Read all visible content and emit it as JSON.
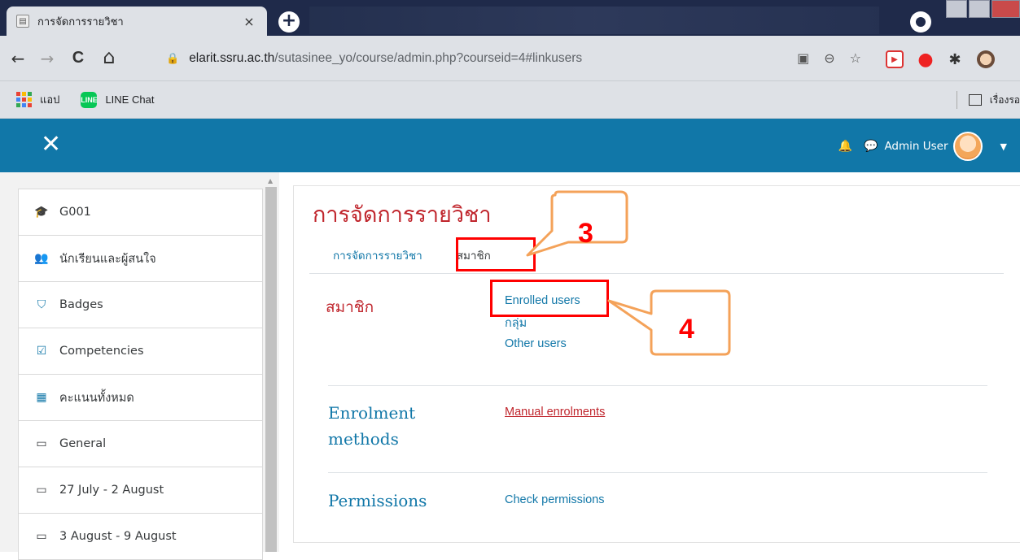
{
  "browser": {
    "tab_title": "การจัดการรายวิชา",
    "tab_close": "×",
    "new_tab": "+",
    "nav": {
      "back": "←",
      "forward": "→",
      "reload": "C",
      "home": "⌂"
    },
    "url_host": "elarit.ssru.ac.th",
    "url_path": "/sutasinee_yo/course/admin.php?courseid=4#linkusers",
    "bookmarks": {
      "apps_label": "แอป",
      "line_label": "LINE Chat",
      "line_icon_text": "LINE",
      "reading_list": "เรื่องรอ"
    },
    "icons": [
      "translate-icon",
      "zoom-icon",
      "star-icon",
      "extension-icon",
      "profile-icon"
    ]
  },
  "navbar": {
    "close_glyph": "✕",
    "user_name": "Admin User",
    "bg_color": "#1177a8"
  },
  "sidebar": {
    "items": [
      {
        "icon": "graduation-cap-icon",
        "glyph": "🎓",
        "label": "G001"
      },
      {
        "icon": "users-icon",
        "glyph": "👥",
        "label": "นักเรียนและผู้สนใจ"
      },
      {
        "icon": "shield-icon",
        "glyph": "⛉",
        "label": "Badges"
      },
      {
        "icon": "checkbox-icon",
        "glyph": "☑",
        "label": "Competencies"
      },
      {
        "icon": "table-icon",
        "glyph": "▦",
        "label": "คะแนนทั้งหมด"
      },
      {
        "icon": "folder-icon",
        "glyph": "▭",
        "label": "General"
      },
      {
        "icon": "folder-icon",
        "glyph": "▭",
        "label": "27 July - 2 August"
      },
      {
        "icon": "folder-icon",
        "glyph": "▭",
        "label": "3 August - 9 August"
      }
    ]
  },
  "main": {
    "title": "การจัดการรายวิชา",
    "tabs": [
      {
        "label": "การจัดการรายวิชา"
      },
      {
        "label": "สมาชิก"
      }
    ],
    "sections": {
      "members": {
        "heading": "สมาชิก",
        "links": [
          "Enrolled users",
          "กลุ่ม",
          "Other users"
        ]
      },
      "enrolment": {
        "heading_line1": "Enrolment",
        "heading_line2": "methods",
        "link": "Manual enrolments"
      },
      "permissions": {
        "heading": "Permissions",
        "link": "Check permissions"
      }
    }
  },
  "annotations": {
    "step3": "3",
    "step4": "4",
    "highlight_color": "#ff0000",
    "callout_border": "#f4a259"
  }
}
